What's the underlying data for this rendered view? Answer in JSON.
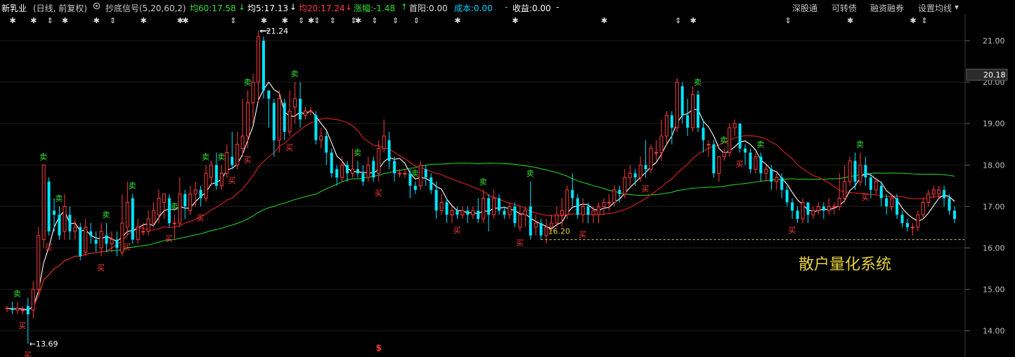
{
  "header": {
    "stock_name": "新乳业",
    "period": "(日线, 前复权)",
    "indicator": "抄底信号(5,20,60,2)",
    "ma60": "均60:17.58",
    "ma60_arrow": "↓",
    "ma5": "均5:17.13",
    "ma5_arrow": "↓",
    "ma20": "均20:17.24",
    "ma20_arrow": "↓",
    "change": "涨幅:-1.48",
    "change_arrow": "↑",
    "first_yang": "首阳:0.00",
    "cost": "成本:0.00",
    "profit": "收益:0.00",
    "dash": "-",
    "menu": [
      "深股通",
      "可转债",
      "融资融券",
      "设置均线"
    ],
    "menu_caret": "▾"
  },
  "colors": {
    "background": "#000000",
    "up": "#ff3c3c",
    "down": "#00e5ff",
    "ma5": "#ffffff",
    "ma20": "#e02020",
    "ma60": "#22cc22",
    "buy": "#ff3c3c",
    "sell": "#33dd33",
    "axis_text": "#c0c0c0",
    "support": "#e6d23c",
    "watermark": "#e6d23c"
  },
  "watermark": "散户量化系统",
  "chart_data": {
    "type": "candlestick",
    "y_ticks": [
      14.0,
      15.0,
      16.0,
      17.0,
      18.0,
      19.0,
      20.0,
      21.0
    ],
    "y_tick_labels": [
      "14.00",
      "15.00",
      "16.00",
      "17.00",
      "18.00",
      "19.00",
      "20.00",
      "21.00"
    ],
    "ylim": [
      13.5,
      21.6
    ],
    "current_price": 20.18,
    "current_price_label": "20.18",
    "annotations": {
      "high": {
        "value": 21.24,
        "label": "21.24",
        "index": 48
      },
      "low": {
        "value": 13.69,
        "label": "13.69",
        "index": 4
      },
      "support": {
        "value": 16.2,
        "label": "16.20",
        "from_index": 102
      }
    },
    "candles": [
      [
        14.55,
        14.55,
        14.45,
        14.6
      ],
      [
        14.55,
        14.5,
        14.4,
        14.7
      ],
      [
        14.5,
        14.55,
        14.4,
        14.7
      ],
      [
        14.5,
        14.5,
        14.4,
        14.6
      ],
      [
        14.6,
        14.4,
        13.69,
        14.8
      ],
      [
        14.5,
        15.0,
        14.3,
        15.2
      ],
      [
        15.0,
        16.3,
        14.9,
        16.5
      ],
      [
        16.2,
        18.0,
        16.0,
        18.0
      ],
      [
        17.6,
        16.4,
        16.3,
        17.7
      ],
      [
        16.9,
        16.8,
        16.4,
        17.2
      ],
      [
        16.8,
        16.3,
        16.2,
        17.0
      ],
      [
        16.4,
        17.0,
        16.2,
        17.3
      ],
      [
        16.8,
        16.4,
        16.2,
        17.0
      ],
      [
        16.4,
        16.5,
        16.2,
        16.7
      ],
      [
        16.5,
        15.8,
        15.7,
        16.6
      ],
      [
        15.9,
        16.5,
        15.8,
        16.7
      ],
      [
        16.4,
        16.3,
        16.1,
        16.6
      ],
      [
        16.2,
        16.1,
        15.9,
        16.4
      ],
      [
        16.0,
        16.4,
        15.8,
        16.6
      ],
      [
        16.3,
        16.1,
        15.9,
        16.6
      ],
      [
        16.1,
        16.2,
        15.9,
        16.4
      ],
      [
        16.2,
        16.0,
        15.8,
        16.4
      ],
      [
        15.9,
        16.6,
        15.8,
        17.3
      ],
      [
        16.5,
        17.1,
        16.3,
        17.6
      ],
      [
        17.2,
        16.2,
        16.1,
        17.3
      ],
      [
        16.2,
        16.5,
        16.1,
        16.7
      ],
      [
        16.4,
        16.4,
        16.3,
        16.6
      ],
      [
        16.4,
        16.7,
        16.3,
        16.9
      ],
      [
        16.6,
        16.9,
        16.5,
        17.1
      ],
      [
        16.8,
        17.2,
        16.6,
        17.4
      ],
      [
        17.1,
        17.3,
        16.7,
        17.3
      ],
      [
        17.2,
        16.6,
        16.5,
        17.3
      ],
      [
        16.6,
        16.6,
        16.2,
        16.8
      ],
      [
        16.6,
        17.3,
        16.5,
        17.7
      ],
      [
        17.3,
        17.0,
        16.7,
        17.4
      ],
      [
        16.9,
        17.3,
        16.8,
        17.5
      ],
      [
        17.3,
        17.4,
        17.0,
        17.6
      ],
      [
        17.4,
        17.2,
        17.0,
        17.5
      ],
      [
        17.2,
        17.8,
        17.1,
        18.0
      ],
      [
        17.7,
        18.0,
        17.5,
        18.1
      ],
      [
        18.0,
        17.5,
        17.4,
        18.3
      ],
      [
        17.5,
        17.8,
        17.4,
        18.0
      ],
      [
        17.8,
        18.3,
        17.7,
        18.5
      ],
      [
        18.2,
        18.0,
        17.9,
        18.8
      ],
      [
        18.0,
        18.5,
        17.9,
        18.8
      ],
      [
        18.4,
        18.7,
        18.2,
        19.6
      ],
      [
        18.7,
        19.5,
        18.4,
        19.8
      ],
      [
        19.5,
        20.0,
        19.0,
        20.2
      ],
      [
        20.0,
        21.1,
        19.5,
        21.24
      ],
      [
        21.0,
        19.8,
        19.6,
        21.1
      ],
      [
        19.8,
        19.6,
        18.9,
        19.8
      ],
      [
        19.5,
        18.6,
        18.2,
        19.6
      ],
      [
        18.6,
        19.6,
        18.3,
        19.8
      ],
      [
        19.5,
        18.8,
        18.6,
        19.6
      ],
      [
        18.8,
        19.3,
        18.7,
        19.8
      ],
      [
        19.4,
        19.6,
        19.0,
        20.0
      ],
      [
        19.6,
        19.1,
        18.9,
        20.0
      ],
      [
        19.2,
        19.3,
        19.1,
        19.4
      ],
      [
        19.3,
        19.3,
        19.2,
        19.4
      ],
      [
        19.2,
        18.6,
        18.5,
        19.3
      ],
      [
        18.6,
        18.7,
        18.4,
        18.9
      ],
      [
        18.7,
        18.3,
        18.0,
        18.8
      ],
      [
        18.3,
        17.8,
        17.7,
        18.4
      ],
      [
        17.9,
        17.7,
        17.5,
        18.0
      ],
      [
        17.7,
        18.0,
        17.6,
        18.2
      ],
      [
        18.0,
        17.8,
        17.6,
        18.1
      ],
      [
        17.8,
        17.9,
        17.7,
        18.4
      ],
      [
        17.9,
        17.8,
        17.7,
        18.1
      ],
      [
        17.8,
        17.6,
        17.5,
        18.0
      ],
      [
        17.7,
        18.0,
        17.6,
        18.2
      ],
      [
        18.1,
        17.7,
        17.6,
        18.2
      ],
      [
        17.8,
        18.4,
        17.6,
        18.6
      ],
      [
        18.4,
        18.7,
        18.3,
        19.1
      ],
      [
        18.6,
        18.1,
        17.9,
        18.8
      ],
      [
        18.1,
        17.8,
        17.6,
        18.2
      ],
      [
        17.8,
        17.8,
        17.7,
        17.9
      ],
      [
        17.8,
        17.8,
        17.7,
        17.9
      ],
      [
        17.8,
        17.5,
        17.2,
        17.9
      ],
      [
        17.5,
        17.4,
        17.3,
        17.6
      ],
      [
        17.5,
        18.0,
        17.4,
        18.1
      ],
      [
        17.9,
        17.7,
        17.5,
        18.0
      ],
      [
        17.7,
        17.4,
        17.3,
        17.8
      ],
      [
        17.4,
        16.9,
        16.7,
        17.6
      ],
      [
        16.9,
        17.1,
        16.8,
        17.3
      ],
      [
        17.1,
        16.8,
        16.6,
        17.2
      ],
      [
        16.8,
        16.9,
        16.6,
        17.0
      ],
      [
        16.9,
        16.8,
        16.7,
        17.0
      ],
      [
        16.8,
        16.9,
        16.7,
        17.0
      ],
      [
        16.9,
        16.8,
        16.6,
        17.0
      ],
      [
        16.8,
        16.9,
        16.7,
        17.0
      ],
      [
        16.9,
        16.7,
        16.6,
        17.2
      ],
      [
        16.7,
        17.2,
        16.6,
        17.4
      ],
      [
        17.2,
        16.8,
        16.4,
        17.3
      ],
      [
        16.8,
        17.2,
        16.7,
        17.4
      ],
      [
        17.2,
        16.9,
        16.8,
        17.3
      ],
      [
        16.9,
        16.8,
        16.7,
        17.0
      ],
      [
        16.8,
        17.0,
        16.7,
        17.1
      ],
      [
        17.0,
        16.6,
        16.5,
        17.1
      ],
      [
        16.5,
        16.8,
        16.4,
        17.0
      ],
      [
        16.8,
        16.9,
        16.5,
        17.0
      ],
      [
        17.0,
        16.3,
        16.2,
        17.6
      ],
      [
        16.5,
        16.6,
        16.3,
        16.8
      ],
      [
        16.6,
        16.3,
        16.2,
        16.7
      ],
      [
        16.3,
        16.5,
        16.1,
        16.7
      ],
      [
        16.5,
        16.6,
        16.4,
        16.8
      ],
      [
        16.6,
        16.8,
        16.5,
        17.0
      ],
      [
        16.8,
        16.9,
        16.5,
        17.2
      ],
      [
        16.8,
        17.4,
        16.7,
        17.5
      ],
      [
        17.4,
        17.2,
        17.0,
        17.8
      ],
      [
        17.2,
        16.8,
        16.7,
        17.3
      ],
      [
        16.8,
        17.0,
        16.6,
        17.2
      ],
      [
        17.0,
        16.8,
        16.6,
        17.1
      ],
      [
        16.8,
        16.9,
        16.6,
        17.0
      ],
      [
        16.8,
        17.0,
        16.6,
        17.1
      ],
      [
        17.0,
        17.1,
        16.8,
        17.2
      ],
      [
        17.1,
        17.1,
        16.9,
        17.3
      ],
      [
        17.1,
        17.4,
        17.0,
        17.5
      ],
      [
        17.4,
        17.3,
        17.1,
        17.5
      ],
      [
        17.3,
        17.7,
        17.2,
        17.9
      ],
      [
        17.7,
        17.8,
        17.5,
        18.0
      ],
      [
        17.8,
        17.7,
        17.5,
        17.9
      ],
      [
        17.7,
        18.0,
        17.6,
        18.2
      ],
      [
        18.0,
        17.9,
        17.7,
        18.6
      ],
      [
        17.9,
        18.4,
        17.8,
        18.5
      ],
      [
        18.3,
        18.3,
        18.1,
        18.6
      ],
      [
        18.3,
        18.7,
        18.1,
        19.1
      ],
      [
        18.7,
        19.2,
        18.5,
        19.3
      ],
      [
        19.2,
        18.9,
        18.5,
        19.3
      ],
      [
        18.9,
        20.0,
        18.8,
        20.1
      ],
      [
        19.9,
        19.2,
        19.0,
        20.0
      ],
      [
        19.2,
        18.9,
        18.7,
        19.6
      ],
      [
        18.9,
        19.7,
        18.8,
        19.9
      ],
      [
        19.7,
        18.9,
        18.8,
        19.8
      ],
      [
        18.9,
        18.6,
        18.3,
        19.1
      ],
      [
        18.5,
        18.5,
        18.2,
        18.6
      ],
      [
        18.5,
        17.8,
        17.7,
        18.6
      ],
      [
        17.8,
        18.2,
        17.6,
        18.2
      ],
      [
        18.2,
        18.3,
        18.1,
        18.4
      ],
      [
        18.3,
        18.9,
        18.2,
        19.0
      ],
      [
        18.9,
        19.0,
        18.7,
        19.1
      ],
      [
        19.0,
        18.4,
        18.3,
        19.0
      ],
      [
        18.4,
        18.3,
        18.0,
        18.5
      ],
      [
        18.3,
        17.9,
        17.8,
        18.4
      ],
      [
        17.9,
        18.2,
        17.8,
        18.3
      ],
      [
        18.2,
        17.8,
        17.6,
        18.3
      ],
      [
        17.8,
        17.9,
        17.6,
        18.0
      ],
      [
        17.9,
        17.6,
        17.4,
        18.0
      ],
      [
        17.6,
        17.7,
        17.4,
        17.8
      ],
      [
        17.7,
        17.4,
        17.2,
        17.8
      ],
      [
        17.4,
        17.1,
        17.0,
        17.5
      ],
      [
        17.1,
        16.9,
        16.7,
        17.2
      ],
      [
        16.9,
        16.7,
        16.6,
        17.0
      ],
      [
        16.7,
        17.1,
        16.6,
        17.2
      ],
      [
        17.1,
        16.8,
        16.6,
        17.1
      ],
      [
        16.8,
        16.9,
        16.7,
        17.0
      ],
      [
        16.9,
        17.0,
        16.8,
        17.1
      ],
      [
        17.0,
        16.9,
        16.7,
        17.1
      ],
      [
        16.9,
        17.0,
        16.8,
        17.2
      ],
      [
        17.0,
        17.0,
        16.8,
        17.1
      ],
      [
        17.0,
        17.2,
        16.9,
        17.8
      ],
      [
        17.2,
        17.6,
        17.1,
        18.0
      ],
      [
        17.6,
        18.1,
        17.5,
        18.2
      ],
      [
        18.1,
        17.6,
        17.4,
        18.3
      ],
      [
        17.6,
        18.0,
        17.5,
        18.3
      ],
      [
        18.0,
        17.7,
        17.5,
        18.2
      ],
      [
        17.7,
        17.4,
        17.2,
        17.8
      ],
      [
        17.4,
        17.6,
        17.3,
        17.7
      ],
      [
        17.5,
        17.2,
        17.0,
        17.6
      ],
      [
        17.2,
        17.0,
        16.8,
        17.3
      ],
      [
        17.0,
        17.2,
        16.9,
        17.3
      ],
      [
        17.2,
        16.8,
        16.7,
        17.3
      ],
      [
        16.8,
        16.6,
        16.5,
        16.9
      ],
      [
        16.6,
        16.5,
        16.4,
        16.7
      ],
      [
        16.5,
        16.5,
        16.3,
        16.6
      ],
      [
        16.5,
        16.8,
        16.4,
        16.9
      ],
      [
        16.8,
        17.1,
        16.7,
        17.2
      ],
      [
        17.1,
        17.3,
        17.0,
        17.4
      ],
      [
        17.3,
        17.4,
        17.2,
        17.5
      ],
      [
        17.3,
        17.4,
        17.2,
        17.5
      ],
      [
        17.4,
        17.2,
        17.0,
        17.5
      ],
      [
        17.2,
        16.9,
        16.8,
        17.3
      ],
      [
        16.9,
        16.7,
        16.6,
        17.0
      ]
    ],
    "buy_signals": [
      3,
      4,
      8,
      18,
      23,
      31,
      37,
      43,
      46,
      54,
      71,
      86,
      98,
      110,
      122,
      140,
      150,
      164
    ],
    "sell_signals": [
      2,
      7,
      10,
      19,
      24,
      32,
      38,
      41,
      46,
      55,
      67,
      78,
      91,
      100,
      132,
      137,
      144,
      163
    ],
    "star_markers": [
      1,
      5,
      11,
      17,
      26,
      33,
      34,
      49,
      53,
      58,
      67,
      86,
      97,
      114,
      131,
      161,
      173
    ],
    "arrow_markers": [
      8,
      20,
      43,
      56,
      59,
      62,
      66,
      70,
      74,
      78,
      128,
      149,
      175
    ],
    "dollar_marker": {
      "index": 71,
      "label": "$"
    }
  }
}
